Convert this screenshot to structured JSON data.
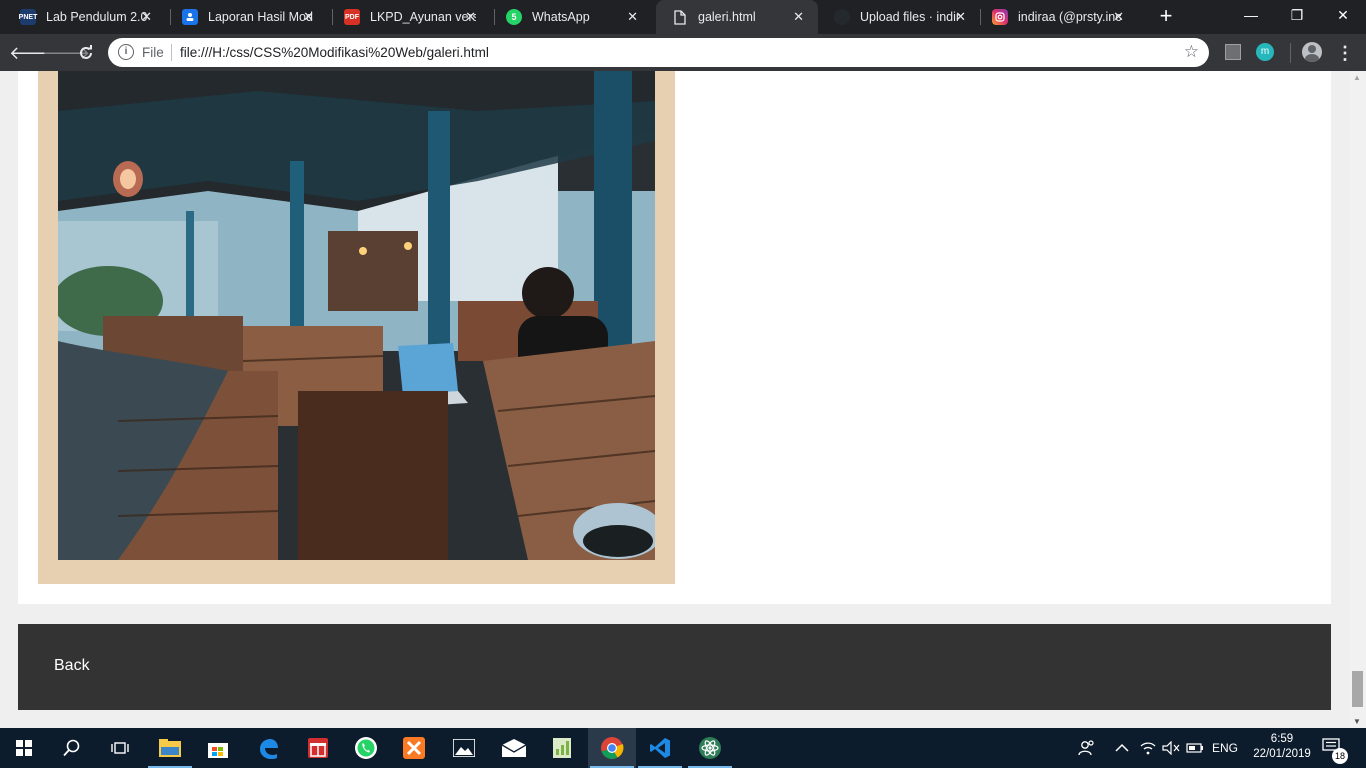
{
  "browser": {
    "tabs": [
      {
        "title": "Lab Pendulum 2.0",
        "favicon": "pnet-icon",
        "color": "#1d3c6e"
      },
      {
        "title": "Laporan Hasil Mod",
        "favicon": "doc-user-icon",
        "color": "#1a73e8"
      },
      {
        "title": "LKPD_Ayunan vers",
        "favicon": "pdf-icon",
        "color": "#d93025"
      },
      {
        "title": "WhatsApp",
        "favicon": "whatsapp-icon",
        "color": "#25d366"
      },
      {
        "title": "galeri.html",
        "favicon": "file-icon",
        "color": "#e8eaed"
      },
      {
        "title": "Upload files · indir",
        "favicon": "github-icon",
        "color": "#24292e"
      },
      {
        "title": "indiraa (@prsty.inc",
        "favicon": "instagram-icon",
        "color": "#e1306c"
      }
    ],
    "whatsapp_badge": "5",
    "pdf_label": "PDF",
    "pnet_label": "PNET",
    "omnibox": {
      "security_label": "File",
      "url": "file:///H:/css/CSS%20Modifikasi%20Web/galeri.html"
    },
    "extension_letter": "m"
  },
  "page": {
    "footer": {
      "back_label": "Back"
    }
  },
  "taskbar": {
    "apps": [
      "start-icon",
      "search-icon",
      "task-view-icon",
      "file-explorer-icon",
      "store-icon",
      "edge-icon",
      "gift-icon",
      "whatsapp-icon",
      "xampp-icon",
      "photos-icon",
      "mail-icon",
      "notepad-plus-plus-icon",
      "chrome-icon",
      "vscode-icon",
      "atom-icon"
    ],
    "language": "ENG",
    "time": "6:59",
    "date": "22/01/2019",
    "notification_count": "18"
  }
}
